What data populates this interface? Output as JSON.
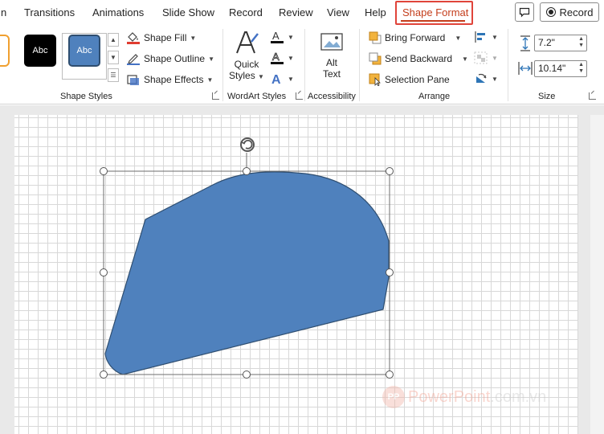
{
  "tabs": [
    {
      "label": "n",
      "active": false
    },
    {
      "label": "Transitions",
      "active": false
    },
    {
      "label": "Animations",
      "active": false
    },
    {
      "label": "Slide Show",
      "active": false
    },
    {
      "label": "Record",
      "active": false
    },
    {
      "label": "Review",
      "active": false
    },
    {
      "label": "View",
      "active": false
    },
    {
      "label": "Help",
      "active": false
    },
    {
      "label": "Shape Format",
      "active": true
    }
  ],
  "header_right": {
    "record_label": "Record"
  },
  "ribbon": {
    "shape_styles": {
      "presets": [
        "Abc",
        "Abc"
      ],
      "shape_fill": "Shape Fill",
      "shape_outline": "Shape Outline",
      "shape_effects": "Shape Effects",
      "group_label": "Shape Styles"
    },
    "wordart": {
      "quick_styles_line1": "Quick",
      "quick_styles_line2": "Styles",
      "group_label": "WordArt Styles"
    },
    "accessibility": {
      "alt_text_line1": "Alt",
      "alt_text_line2": "Text",
      "group_label": "Accessibility"
    },
    "arrange": {
      "bring_forward": "Bring Forward",
      "send_backward": "Send Backward",
      "selection_pane": "Selection Pane",
      "group_label": "Arrange"
    },
    "size": {
      "height": "7.2\"",
      "width": "10.14\"",
      "group_label": "Size"
    }
  },
  "watermark": {
    "brand": "PowerPoint",
    "suffix": ".com.vn",
    "logo": "PP"
  },
  "colors": {
    "accent": "#c43e1c",
    "highlight_box": "#e0443a",
    "shape_fill": "#4f81bd",
    "shape_outline": "#2f4e70"
  }
}
